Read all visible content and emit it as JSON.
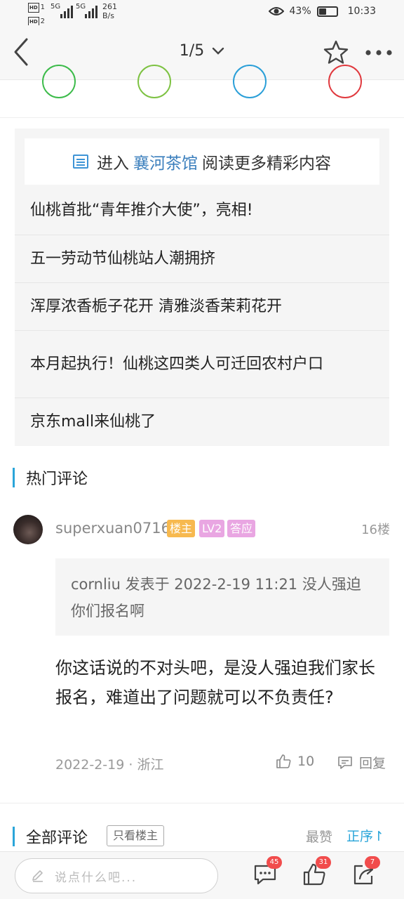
{
  "status_bar": {
    "hd1": "HD",
    "sim1": "1",
    "hd2": "HD",
    "sim2": "2",
    "net1": "5G",
    "net2": "5G",
    "speed_value": "261",
    "speed_unit": "B/s",
    "battery": "43%",
    "battery_level": 0.43,
    "time": "10:33"
  },
  "nav": {
    "page_indicator": "1/5"
  },
  "share": {
    "colors": [
      "#3cbb4a",
      "#7dc242",
      "#2a9fd8",
      "#e0393e"
    ]
  },
  "related": {
    "enter_prefix": "进入",
    "forum_name": "襄河茶馆",
    "enter_suffix": "阅读更多精彩内容",
    "items": [
      "仙桃首批“青年推介大使”，亮相!",
      "五一劳动节仙桃站人潮拥挤",
      "浑厚浓香栀子花开 清雅淡香茉莉花开",
      "本月起执行！仙桃这四类人可迁回农村户口",
      "京东mall来仙桃了"
    ]
  },
  "hot_comments": {
    "title": "热门评论",
    "comment": {
      "username": "superxuan0716",
      "badges": [
        {
          "text": "楼主",
          "color": "#f7b94f"
        },
        {
          "text": "LV2",
          "color": "#e9a6e2"
        },
        {
          "text": "答应",
          "color": "#e9a6e2"
        }
      ],
      "floor": "16楼",
      "quote": "cornliu 发表于 2022-2-19 11:21 没人强迫你们报名啊",
      "body": "你这话说的不对头吧，是没人强迫我们家长报名，难道出了问题就可以不负责任?",
      "date_location": "2022-2-19 · 浙江",
      "likes": "10",
      "reply_label": "回复"
    }
  },
  "all_comments": {
    "title": "全部评论",
    "only_op_label": "只看楼主",
    "sort_hot": "最赞",
    "sort_asc": "正序↾"
  },
  "bottom_bar": {
    "input_placeholder": "说点什么吧...",
    "comment_count": "45",
    "like_count": "31",
    "share_count": "7"
  },
  "colors": {
    "accent": "#2aa5d9",
    "forum_link": "#3b7fbd",
    "badge_red": "#f14c4c"
  }
}
